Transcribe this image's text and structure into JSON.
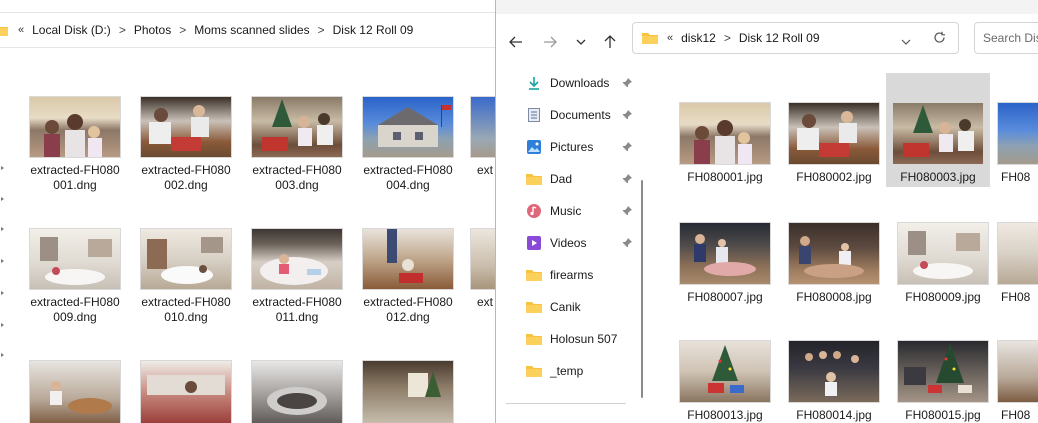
{
  "back_window": {
    "breadcrumb": {
      "overflow": "«",
      "items": [
        "Local Disk (D:)",
        "Photos",
        "Moms scanned slides",
        "Disk 12 Roll 09"
      ],
      "separator": ">"
    },
    "files": [
      {
        "name": "extracted-FH080\n001.dng",
        "line1": "extracted-FH080",
        "line2": "001.dng"
      },
      {
        "name": "extracted-FH080\n002.dng",
        "line1": "extracted-FH080",
        "line2": "002.dng"
      },
      {
        "name": "extracted-FH080\n003.dng",
        "line1": "extracted-FH080",
        "line2": "003.dng"
      },
      {
        "name": "extracted-FH080\n004.dng",
        "line1": "extracted-FH080",
        "line2": "004.dng"
      },
      {
        "line1": "ext",
        "line2": ""
      },
      {
        "line1": "extracted-FH080",
        "line2": "009.dng"
      },
      {
        "line1": "extracted-FH080",
        "line2": "010.dng"
      },
      {
        "line1": "extracted-FH080",
        "line2": "011.dng"
      },
      {
        "line1": "extracted-FH080",
        "line2": "012.dng"
      },
      {
        "line1": "ext",
        "line2": ""
      }
    ]
  },
  "front_window": {
    "nav": {
      "back_icon": "arrow-left-icon",
      "forward_icon": "arrow-right-icon",
      "recent_icon": "chevron-down-icon",
      "up_icon": "arrow-up-icon"
    },
    "address": {
      "overflow": "«",
      "items": [
        "disk12",
        "Disk 12 Roll 09"
      ],
      "separator": ">",
      "dropdown_icon": "chevron-down-icon",
      "refresh_icon": "refresh-icon"
    },
    "search": {
      "placeholder": "Search Disk"
    },
    "nav_pane": [
      {
        "label": "Downloads",
        "icon": "download-icon",
        "pinned": true
      },
      {
        "label": "Documents",
        "icon": "document-icon",
        "pinned": true
      },
      {
        "label": "Pictures",
        "icon": "pictures-icon",
        "pinned": true
      },
      {
        "label": "Dad",
        "icon": "folder-icon",
        "pinned": true
      },
      {
        "label": "Music",
        "icon": "music-icon",
        "pinned": true
      },
      {
        "label": "Videos",
        "icon": "videos-icon",
        "pinned": true
      },
      {
        "label": "firearms",
        "icon": "folder-icon",
        "pinned": false
      },
      {
        "label": "Canik",
        "icon": "folder-icon",
        "pinned": false
      },
      {
        "label": "Holosun 507",
        "icon": "folder-icon",
        "pinned": false
      },
      {
        "label": "_temp",
        "icon": "folder-icon",
        "pinned": false
      }
    ],
    "files": [
      {
        "name": "FH080001.jpg"
      },
      {
        "name": "FH080002.jpg"
      },
      {
        "name": "FH080003.jpg",
        "selected": true
      },
      {
        "name": "FH08"
      },
      {
        "name": "FH080007.jpg"
      },
      {
        "name": "FH080008.jpg"
      },
      {
        "name": "FH080009.jpg"
      },
      {
        "name": "FH08"
      },
      {
        "name": "FH080013.jpg"
      },
      {
        "name": "FH080014.jpg"
      },
      {
        "name": "FH080015.jpg"
      },
      {
        "name": "FH08"
      }
    ]
  },
  "colors": {
    "selection": "#d9d9d9",
    "folder_yellow": "#f7c33c",
    "accent_teal": "#1ba39c",
    "accent_blue": "#2f7fd8"
  }
}
